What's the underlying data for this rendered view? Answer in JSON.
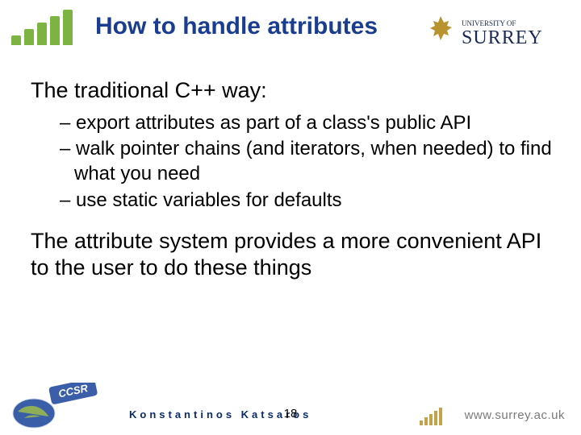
{
  "header": {
    "title": "How to handle attributes",
    "university_top": "UNIVERSITY OF",
    "university_name": "SURREY"
  },
  "body": {
    "para1": "The traditional C++ way:",
    "bullets": [
      "export attributes as part of a class's public API",
      "walk pointer chains (and iterators, when needed) to find what you need",
      "use static variables for defaults"
    ],
    "para2": "The attribute system provides a more convenient API to the user to do these things"
  },
  "footer": {
    "author": "Konstantinos Katsaros",
    "page": "18",
    "site": "www.surrey.ac.uk",
    "ccsr": "CCSR"
  }
}
